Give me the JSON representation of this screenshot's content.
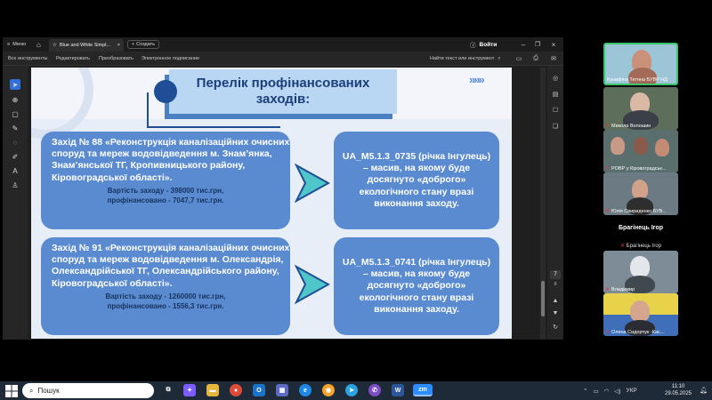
{
  "viewer": {
    "menu_label": "Меню",
    "tab_title": "Blue and White Simpl...",
    "new_tab_label": "Создать",
    "signin_label": "Войти",
    "toolbar": {
      "all_tools": "Все инструменты",
      "edit": "Редактировать",
      "convert": "Преобразовать",
      "esign": "Электронное подписание",
      "find": "Найти текст или инструмент"
    },
    "page_current": "7",
    "page_total": "8"
  },
  "slide": {
    "title": "Перелік профінансованих заходів:",
    "chevrons": "»»»",
    "rows": [
      {
        "main": "Захід № 88 «Реконструкція каналізаційних очисних споруд та мереж водовідведення м. Знам’янка, Знам’янської ТГ, Кропивницького району, Кіровоградської області».",
        "cost": "Вартість заходу - 398000 тис.грн,",
        "financed": "профінансовано - 7047,7 тис.грн.",
        "target": "UA_M5.1.3_0735 (річка Інгулець) – масив, на якому буде досягнуто «доброго» екологічного стану вразі виконання заходу."
      },
      {
        "main": "Захід № 91 «Реконструкція каналізаційних очисних споруд та мереж водовідведення м. Олександрія, Олександрійської ТГ, Олександрійського району, Кіровоградської області».",
        "cost": "Вартість заходу - 1260000 тис.грн,",
        "financed": "профінансовано - 1556,3 тис.грн.",
        "target": "UA_M5.1.3_0741 (річка Інгулець) – масив, на якому буде досягнуто «доброго» екологічного стану вразі виконання заходу."
      }
    ]
  },
  "participants": [
    {
      "name": "Кунафіна Тетяна БУВР НД"
    },
    {
      "name": "Микола Волошин"
    },
    {
      "name": "РОВР у Кіровоградськ..."
    },
    {
      "name": "Юлія Свириденко БУВ..."
    },
    {
      "name": "Брагінець Ігор",
      "large": true
    },
    {
      "name": "Брагінець Ігор",
      "small": true
    },
    {
      "name": "Владимир"
    },
    {
      "name": "Олена Сидорчук -Кас..."
    }
  ],
  "taskbar": {
    "search_label": "Пошук",
    "lang": "УКР",
    "time": "11:10",
    "date": "29.05.2025"
  }
}
